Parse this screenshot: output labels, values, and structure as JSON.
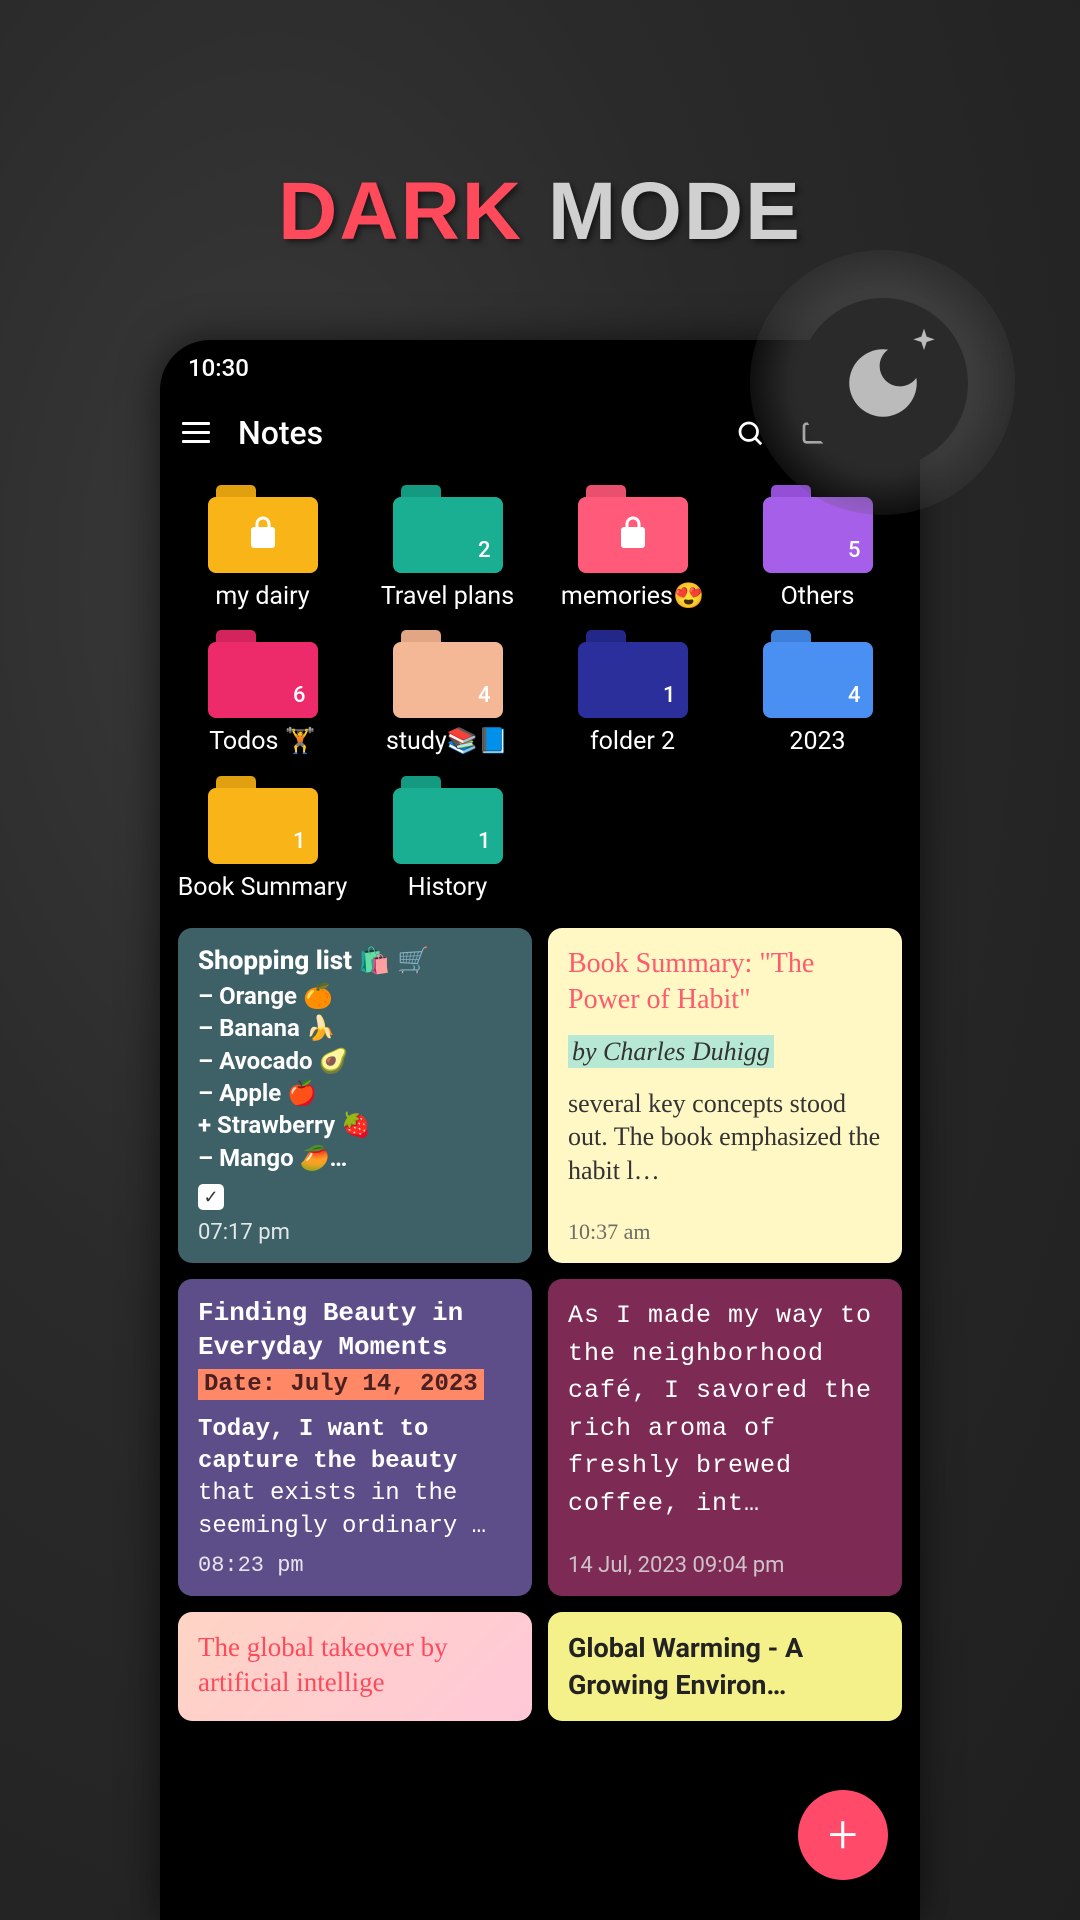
{
  "headline": {
    "dark": "DARK",
    "mode": "MODE"
  },
  "statusBar": {
    "time": "10:30"
  },
  "appBar": {
    "title": "Notes"
  },
  "folders": [
    {
      "label": "my dairy",
      "color": "#f9b417",
      "tab": "#e0a010",
      "locked": true,
      "count": null
    },
    {
      "label": "Travel plans",
      "color": "#1aae93",
      "tab": "#159a82",
      "locked": false,
      "count": "2"
    },
    {
      "label": "memories😍",
      "color": "#ff5a7a",
      "tab": "#e8506e",
      "locked": true,
      "count": null
    },
    {
      "label": "Others",
      "color": "#a65fe8",
      "tab": "#9350d6",
      "locked": false,
      "count": "5"
    },
    {
      "label": "Todos 🏋️",
      "color": "#ed2a6a",
      "tab": "#d4245e",
      "locked": false,
      "count": "6"
    },
    {
      "label": "study📚📘",
      "color": "#f4b896",
      "tab": "#e2a684",
      "locked": false,
      "count": "4"
    },
    {
      "label": "folder 2",
      "color": "#2a2f9c",
      "tab": "#232888",
      "locked": false,
      "count": "1"
    },
    {
      "label": "2023",
      "color": "#4a90f2",
      "tab": "#3d7fd9",
      "locked": false,
      "count": "4"
    },
    {
      "label": "Book Summary",
      "color": "#f9b417",
      "tab": "#e0a010",
      "locked": false,
      "count": "1"
    },
    {
      "label": "History",
      "color": "#1aae93",
      "tab": "#159a82",
      "locked": false,
      "count": "1"
    }
  ],
  "notes": {
    "shopping": {
      "title": "Shopping list 🛍️ 🛒",
      "items": [
        "– Orange 🍊",
        "– Banana 🍌",
        "– Avocado 🥑",
        "– Apple 🍎",
        "+ Strawberry 🍓",
        "– Mango 🥭…"
      ],
      "time": "07:17 pm"
    },
    "book": {
      "title": "Book Summary: \"The Power of Habit\"",
      "author": "by Charles Duhigg",
      "body": "several key concepts stood out. The book emphasized the habit l…",
      "time": "10:37 am"
    },
    "beauty": {
      "title": "Finding Beauty in Everyday Moments",
      "date": "Date: July 14, 2023",
      "body1": "Today, I want to capture the beauty",
      "body2": "that exists in the seemingly ordinary …",
      "time": "08:23 pm"
    },
    "cafe": {
      "body": "As I made my way to the neighborhood café, I savored the rich aroma of freshly brewed coffee, int…",
      "time": "14 Jul, 2023 09:04 pm"
    },
    "ai": {
      "title": "The global takeover by artificial intellige"
    },
    "warming": {
      "title": "Global Warming - A Growing Environ…"
    }
  }
}
